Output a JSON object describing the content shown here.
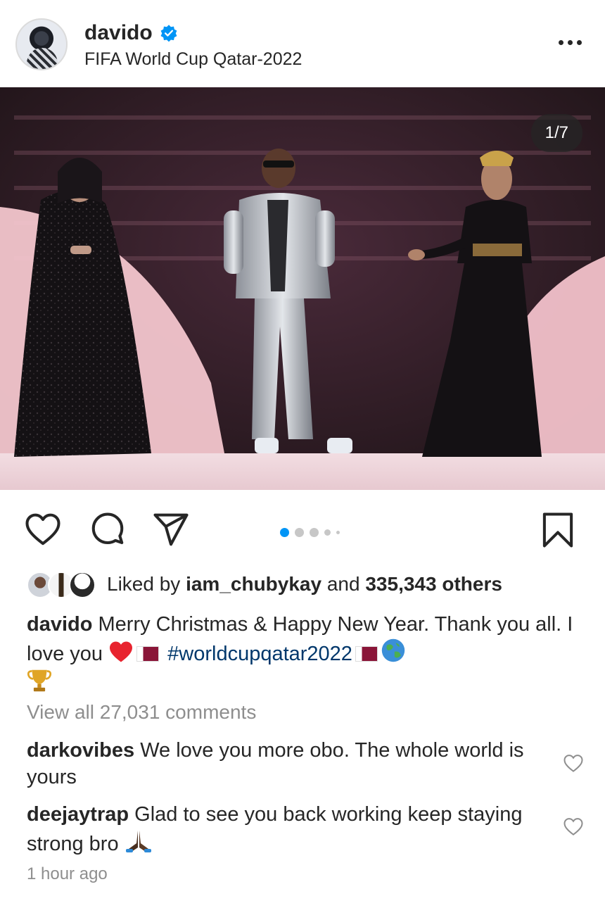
{
  "post": {
    "username": "davido",
    "location": "FIFA World Cup Qatar-2022",
    "image_counter": "1/7",
    "carousel": {
      "total_dots": 5,
      "active_index": 0
    }
  },
  "likes": {
    "prefix": "Liked by ",
    "first_liker": "iam_chubykay",
    "conjunction": " and ",
    "others": "335,343 others"
  },
  "caption": {
    "username": "davido",
    "text": " Merry Christmas & Happy New Year. Thank you all. I love you ",
    "hashtag": "#worldcupqatar2022"
  },
  "comments": {
    "view_all": "View all 27,031 comments",
    "items": [
      {
        "username": "darkovibes",
        "text": " We love you more obo. The whole world is yours"
      },
      {
        "username": "deejaytrap",
        "text": " Glad to see you back working keep staying strong bro "
      }
    ]
  },
  "timestamp": "1 hour ago",
  "icons": {
    "verified": "verified-badge-icon",
    "more": "more-options-icon",
    "like": "heart-icon",
    "comment": "comment-icon",
    "share": "share-icon",
    "save": "bookmark-icon"
  },
  "colors": {
    "accent_blue": "#0095f6",
    "hashtag": "#00376b",
    "muted": "#8e8e8e",
    "text": "#262626"
  }
}
